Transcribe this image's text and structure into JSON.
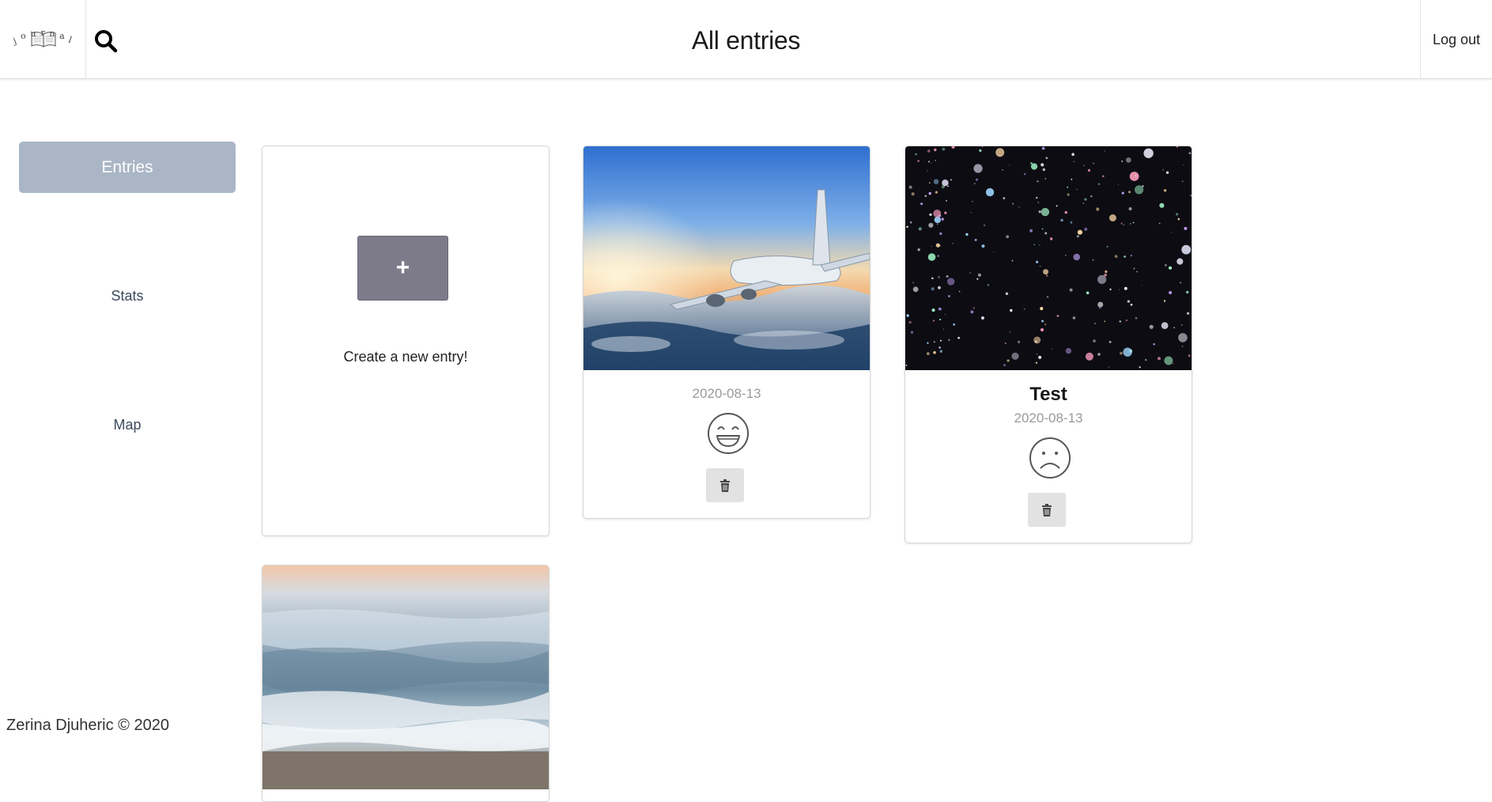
{
  "header": {
    "logo_letters": [
      "j",
      "o",
      "u",
      "r",
      "n",
      "a",
      "l"
    ],
    "title": "All entries",
    "logout_label": "Log out"
  },
  "sidebar": {
    "items": [
      {
        "label": "Entries",
        "active": true
      },
      {
        "label": "Stats",
        "active": false
      },
      {
        "label": "Map",
        "active": false
      }
    ]
  },
  "create_card": {
    "button_label": "+",
    "label": "Create a new entry!"
  },
  "entries": [
    {
      "title": "",
      "date": "2020-08-13",
      "mood": "happy-face-icon",
      "image": "airplane-over-clouds"
    },
    {
      "title": "Test",
      "date": "2020-08-13",
      "mood": "sad-face-icon",
      "image": "colorful-bokeh-space"
    },
    {
      "title": "",
      "date": "",
      "mood": "",
      "image": "beach-waves"
    }
  ],
  "footer": {
    "text": "Zerina Djuheric © 2020"
  },
  "colors": {
    "sidebar_active_bg": "#aab6c5",
    "plus_button_bg": "#7d7b8a",
    "date_text": "#9a9a9a",
    "trash_button_bg": "#e2e2e2"
  }
}
